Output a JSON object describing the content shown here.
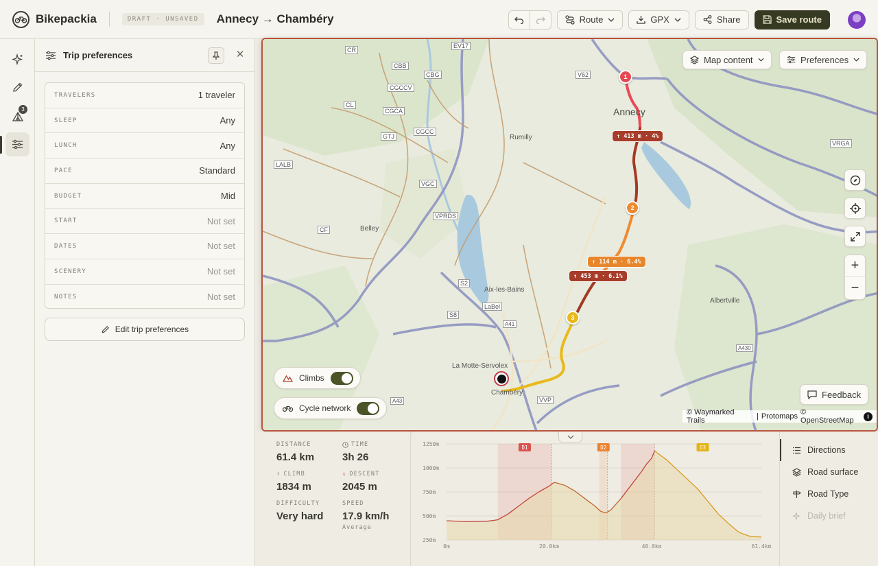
{
  "header": {
    "app_name": "Bikepackia",
    "draft_badge": "DRAFT · UNSAVED",
    "trip_title": "Annecy → Chambéry",
    "route_label": "Route",
    "gpx_label": "GPX",
    "share_label": "Share",
    "save_label": "Save route"
  },
  "rail": {
    "badge_count": "3"
  },
  "panel": {
    "title": "Trip preferences",
    "prefs": [
      {
        "label": "TRAVELERS",
        "value": "1 traveler"
      },
      {
        "label": "SLEEP",
        "value": "Any"
      },
      {
        "label": "LUNCH",
        "value": "Any"
      },
      {
        "label": "PACE",
        "value": "Standard"
      },
      {
        "label": "BUDGET",
        "value": "Mid"
      },
      {
        "label": "START",
        "value": "Not set"
      },
      {
        "label": "DATES",
        "value": "Not set"
      },
      {
        "label": "SCENERY",
        "value": "Not set"
      },
      {
        "label": "NOTES",
        "value": "Not set"
      }
    ],
    "edit_label": "Edit trip preferences"
  },
  "map": {
    "content_label": "Map content",
    "preferences_label": "Preferences",
    "feedback_label": "Feedback",
    "toggles": {
      "climbs": "Climbs",
      "cycle_network": "Cycle network"
    },
    "attribution": {
      "waymarked": "© Waymarked Trails",
      "sep": "|",
      "protomaps": "Protomaps",
      "osm": "© OpenStreetMap"
    },
    "climb_labels": [
      "↑ 413 m · 4%",
      "↑ 114 m · 6.4%",
      "↑ 453 m · 6.1%"
    ],
    "markers": [
      "1",
      "2",
      "3"
    ],
    "places": [
      "Annecy",
      "Rumilly",
      "Belley",
      "Aix-les-Bains",
      "La Motte-Servolex",
      "Chambéry",
      "Albertville"
    ],
    "route_refs": [
      "EV17",
      "CR",
      "CBB",
      "CBG",
      "CGCCV",
      "CL",
      "CGCA",
      "GTJ",
      "CGCC",
      "LALB",
      "VGC",
      "CF",
      "VPRDS",
      "V62",
      "VRGA",
      "LaBel",
      "S2",
      "S8",
      "VVP",
      "A41",
      "A43",
      "A430"
    ]
  },
  "stats": {
    "distance": {
      "label": "DISTANCE",
      "value": "61.4 km"
    },
    "time": {
      "label": "TIME",
      "value": "3h 26"
    },
    "climb": {
      "label": "CLIMB",
      "value": "1834 m"
    },
    "descent": {
      "label": "DESCENT",
      "value": "2045 m"
    },
    "difficulty": {
      "label": "DIFFICULTY",
      "value": "Very hard"
    },
    "speed": {
      "label": "SPEED",
      "value": "17.9 km/h",
      "sub": "Average"
    }
  },
  "chart_data": {
    "type": "area",
    "x_unit": "km",
    "y_unit": "m",
    "y_ticks": [
      "1250m",
      "1000m",
      "750m",
      "500m",
      "250m"
    ],
    "x_ticks": [
      "0m",
      "20.0km",
      "40.0km",
      "61.4km"
    ],
    "xlim": [
      0,
      61.4
    ],
    "ylim": [
      250,
      1250
    ],
    "climb_markers": [
      {
        "label": "D1",
        "start": 10,
        "end": 20.5,
        "color": "#d9534f"
      },
      {
        "label": "D2",
        "start": 29.8,
        "end": 31.4,
        "color": "#e98433"
      },
      {
        "label": "D3",
        "start": 34,
        "end": 40.6,
        "color": "#d9534f"
      }
    ],
    "d3_label_color": "#e2b416",
    "x": [
      0,
      4,
      8,
      10,
      12,
      14,
      16,
      18,
      20,
      21,
      23,
      25,
      27,
      29,
      30,
      31,
      32,
      34,
      36,
      38,
      39,
      40,
      40.6,
      41,
      43,
      45,
      47,
      49,
      51,
      53,
      55,
      57,
      59,
      61.4
    ],
    "elevation": [
      450,
      440,
      445,
      460,
      520,
      600,
      680,
      750,
      810,
      850,
      820,
      760,
      680,
      600,
      550,
      530,
      560,
      680,
      820,
      960,
      1040,
      1100,
      1180,
      1160,
      1080,
      980,
      880,
      780,
      650,
      520,
      420,
      330,
      290,
      280
    ]
  },
  "tabs": [
    "Directions",
    "Road surface",
    "Road Type",
    "Daily brief"
  ]
}
